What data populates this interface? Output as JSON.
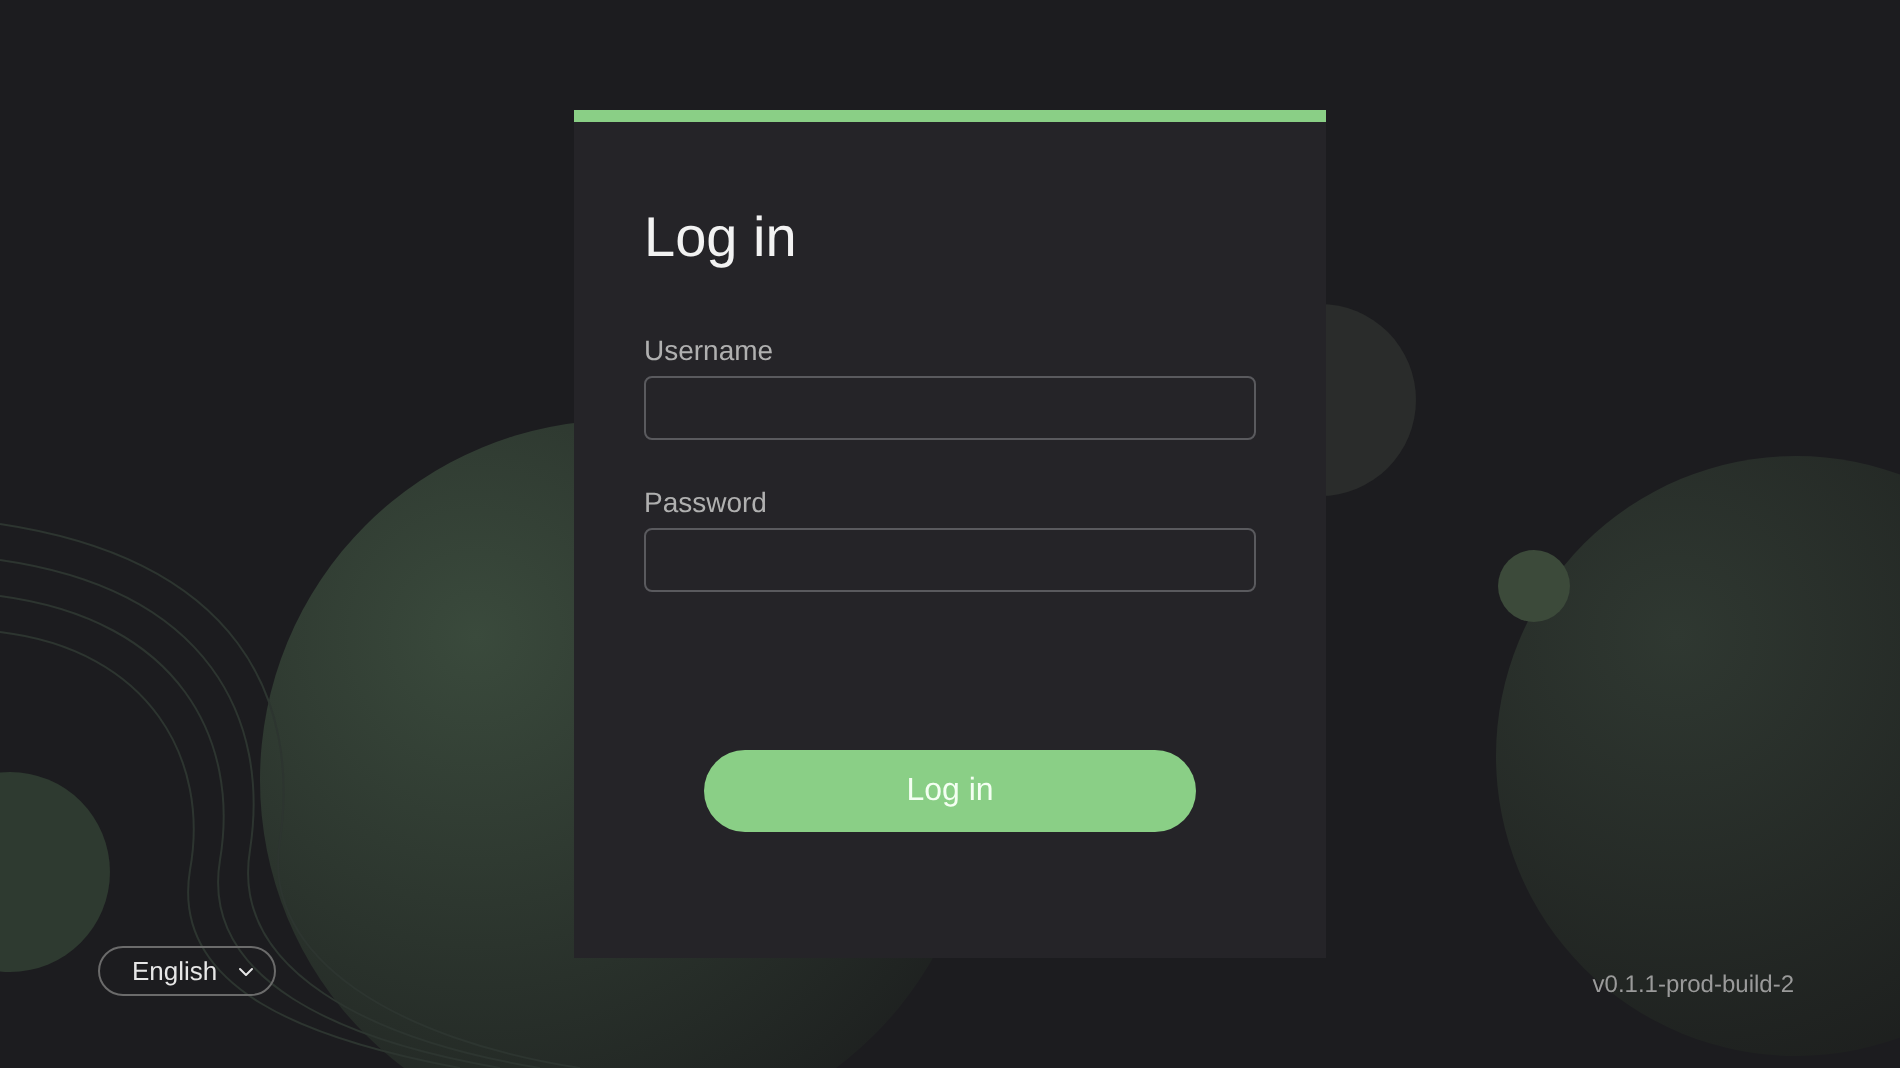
{
  "login_card": {
    "title": "Log in",
    "fields": [
      {
        "label": "Username"
      },
      {
        "label": "Password"
      }
    ],
    "submit_button": "Log in"
  },
  "language_select": {
    "value": "English"
  },
  "version": "v0.1.1-prod-build-2"
}
